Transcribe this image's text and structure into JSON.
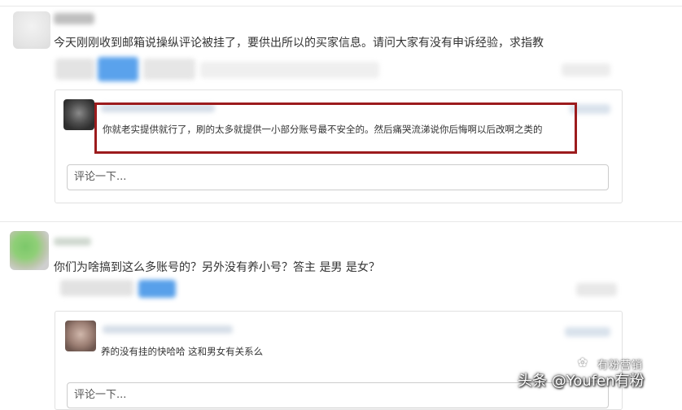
{
  "thread1": {
    "comment": "今天刚刚收到邮箱说操纵评论被挂了，要供出所以的买家信息。请问大家有没有申诉经验，求指教",
    "reply": "你就老实提供就行了，刷的太多就提供一小部分账号最不安全的。然后痛哭流涕说你后悔啊以后改啊之类的",
    "input_placeholder": "评论一下..."
  },
  "thread2": {
    "comment": "你们为啥搞到这么多账号的？另外没有养小号？答主 是男 是女？",
    "reply": "养的没有挂的快哈哈 这和男女有关系么",
    "input_placeholder": "评论一下..."
  },
  "watermark": {
    "brand": "有粉营销",
    "text": "头条 @Youfen有粉"
  },
  "colors": {
    "highlight_border": "#9c1b1d",
    "accent_blue": "#5aa2ec"
  }
}
